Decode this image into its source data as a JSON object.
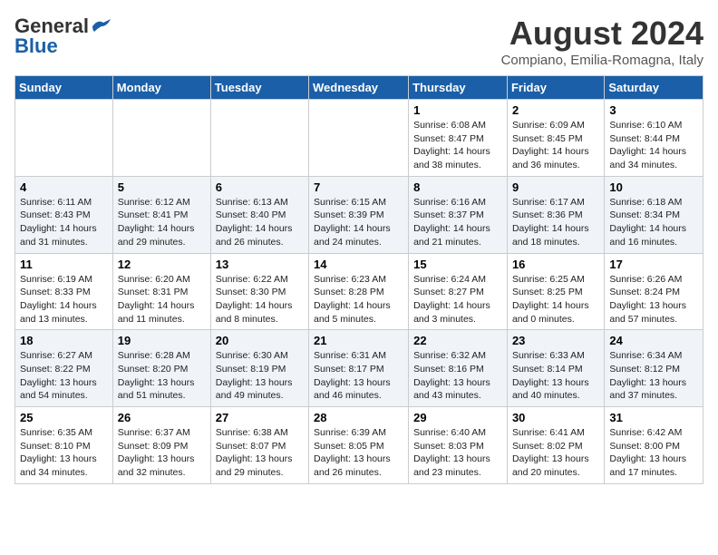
{
  "header": {
    "logo_general": "General",
    "logo_blue": "Blue",
    "month_year": "August 2024",
    "location": "Compiano, Emilia-Romagna, Italy"
  },
  "weekdays": [
    "Sunday",
    "Monday",
    "Tuesday",
    "Wednesday",
    "Thursday",
    "Friday",
    "Saturday"
  ],
  "weeks": [
    [
      {
        "day": "",
        "detail": ""
      },
      {
        "day": "",
        "detail": ""
      },
      {
        "day": "",
        "detail": ""
      },
      {
        "day": "",
        "detail": ""
      },
      {
        "day": "1",
        "detail": "Sunrise: 6:08 AM\nSunset: 8:47 PM\nDaylight: 14 hours\nand 38 minutes."
      },
      {
        "day": "2",
        "detail": "Sunrise: 6:09 AM\nSunset: 8:45 PM\nDaylight: 14 hours\nand 36 minutes."
      },
      {
        "day": "3",
        "detail": "Sunrise: 6:10 AM\nSunset: 8:44 PM\nDaylight: 14 hours\nand 34 minutes."
      }
    ],
    [
      {
        "day": "4",
        "detail": "Sunrise: 6:11 AM\nSunset: 8:43 PM\nDaylight: 14 hours\nand 31 minutes."
      },
      {
        "day": "5",
        "detail": "Sunrise: 6:12 AM\nSunset: 8:41 PM\nDaylight: 14 hours\nand 29 minutes."
      },
      {
        "day": "6",
        "detail": "Sunrise: 6:13 AM\nSunset: 8:40 PM\nDaylight: 14 hours\nand 26 minutes."
      },
      {
        "day": "7",
        "detail": "Sunrise: 6:15 AM\nSunset: 8:39 PM\nDaylight: 14 hours\nand 24 minutes."
      },
      {
        "day": "8",
        "detail": "Sunrise: 6:16 AM\nSunset: 8:37 PM\nDaylight: 14 hours\nand 21 minutes."
      },
      {
        "day": "9",
        "detail": "Sunrise: 6:17 AM\nSunset: 8:36 PM\nDaylight: 14 hours\nand 18 minutes."
      },
      {
        "day": "10",
        "detail": "Sunrise: 6:18 AM\nSunset: 8:34 PM\nDaylight: 14 hours\nand 16 minutes."
      }
    ],
    [
      {
        "day": "11",
        "detail": "Sunrise: 6:19 AM\nSunset: 8:33 PM\nDaylight: 14 hours\nand 13 minutes."
      },
      {
        "day": "12",
        "detail": "Sunrise: 6:20 AM\nSunset: 8:31 PM\nDaylight: 14 hours\nand 11 minutes."
      },
      {
        "day": "13",
        "detail": "Sunrise: 6:22 AM\nSunset: 8:30 PM\nDaylight: 14 hours\nand 8 minutes."
      },
      {
        "day": "14",
        "detail": "Sunrise: 6:23 AM\nSunset: 8:28 PM\nDaylight: 14 hours\nand 5 minutes."
      },
      {
        "day": "15",
        "detail": "Sunrise: 6:24 AM\nSunset: 8:27 PM\nDaylight: 14 hours\nand 3 minutes."
      },
      {
        "day": "16",
        "detail": "Sunrise: 6:25 AM\nSunset: 8:25 PM\nDaylight: 14 hours\nand 0 minutes."
      },
      {
        "day": "17",
        "detail": "Sunrise: 6:26 AM\nSunset: 8:24 PM\nDaylight: 13 hours\nand 57 minutes."
      }
    ],
    [
      {
        "day": "18",
        "detail": "Sunrise: 6:27 AM\nSunset: 8:22 PM\nDaylight: 13 hours\nand 54 minutes."
      },
      {
        "day": "19",
        "detail": "Sunrise: 6:28 AM\nSunset: 8:20 PM\nDaylight: 13 hours\nand 51 minutes."
      },
      {
        "day": "20",
        "detail": "Sunrise: 6:30 AM\nSunset: 8:19 PM\nDaylight: 13 hours\nand 49 minutes."
      },
      {
        "day": "21",
        "detail": "Sunrise: 6:31 AM\nSunset: 8:17 PM\nDaylight: 13 hours\nand 46 minutes."
      },
      {
        "day": "22",
        "detail": "Sunrise: 6:32 AM\nSunset: 8:16 PM\nDaylight: 13 hours\nand 43 minutes."
      },
      {
        "day": "23",
        "detail": "Sunrise: 6:33 AM\nSunset: 8:14 PM\nDaylight: 13 hours\nand 40 minutes."
      },
      {
        "day": "24",
        "detail": "Sunrise: 6:34 AM\nSunset: 8:12 PM\nDaylight: 13 hours\nand 37 minutes."
      }
    ],
    [
      {
        "day": "25",
        "detail": "Sunrise: 6:35 AM\nSunset: 8:10 PM\nDaylight: 13 hours\nand 34 minutes."
      },
      {
        "day": "26",
        "detail": "Sunrise: 6:37 AM\nSunset: 8:09 PM\nDaylight: 13 hours\nand 32 minutes."
      },
      {
        "day": "27",
        "detail": "Sunrise: 6:38 AM\nSunset: 8:07 PM\nDaylight: 13 hours\nand 29 minutes."
      },
      {
        "day": "28",
        "detail": "Sunrise: 6:39 AM\nSunset: 8:05 PM\nDaylight: 13 hours\nand 26 minutes."
      },
      {
        "day": "29",
        "detail": "Sunrise: 6:40 AM\nSunset: 8:03 PM\nDaylight: 13 hours\nand 23 minutes."
      },
      {
        "day": "30",
        "detail": "Sunrise: 6:41 AM\nSunset: 8:02 PM\nDaylight: 13 hours\nand 20 minutes."
      },
      {
        "day": "31",
        "detail": "Sunrise: 6:42 AM\nSunset: 8:00 PM\nDaylight: 13 hours\nand 17 minutes."
      }
    ]
  ]
}
